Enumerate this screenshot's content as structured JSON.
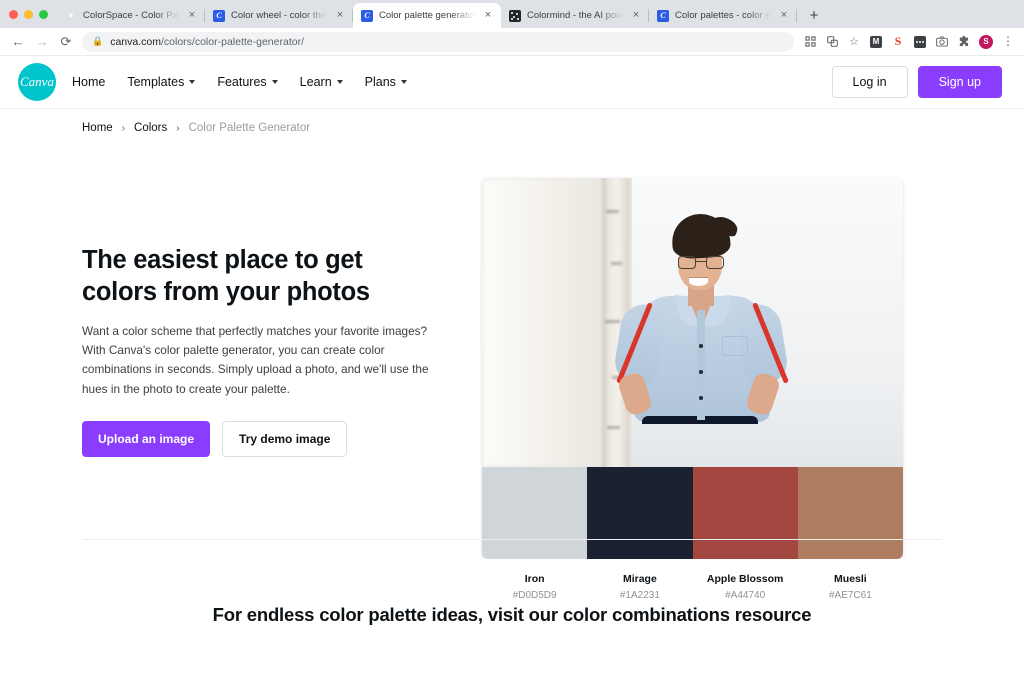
{
  "browser": {
    "traffic_lights": [
      "close",
      "minimize",
      "maximize"
    ],
    "tabs": [
      {
        "title": "ColorSpace - Color Palettes G",
        "favicon": "colorspace-icon",
        "active": false
      },
      {
        "title": "Color wheel - color theory and",
        "favicon": "canva-icon",
        "active": false
      },
      {
        "title": "Color palette generator | Canva",
        "favicon": "canva-icon",
        "active": true
      },
      {
        "title": "Colormind - the AI powered co",
        "favicon": "colormind-icon",
        "active": false
      },
      {
        "title": "Color palettes - color schemes",
        "favicon": "canva-icon",
        "active": false
      }
    ],
    "new_tab_label": "+",
    "back_label": "←",
    "forward_label": "→",
    "reload_label": "⟳",
    "lock_label": "🔒",
    "url_domain": "canva.com",
    "url_path": "/colors/color-palette-generator/",
    "toolbar_icons": [
      {
        "name": "qr-code-icon",
        "glyph": "⌨"
      },
      {
        "name": "translate-icon",
        "glyph": "文"
      },
      {
        "name": "bookmark-star-icon",
        "glyph": "☆"
      },
      {
        "name": "gmail-extension-icon",
        "glyph": "M"
      },
      {
        "name": "grammarly-extension-icon",
        "glyph": "S"
      },
      {
        "name": "screen-recorder-extension-icon",
        "glyph": ""
      },
      {
        "name": "screenshot-extension-icon",
        "glyph": "▭"
      },
      {
        "name": "extensions-puzzle-icon",
        "glyph": "✦"
      },
      {
        "name": "profile-avatar",
        "glyph": "S"
      },
      {
        "name": "chrome-menu-icon",
        "glyph": "⋮"
      }
    ]
  },
  "site": {
    "logo_text": "Canva",
    "nav_items": [
      {
        "label": "Home",
        "has_caret": false
      },
      {
        "label": "Templates",
        "has_caret": true
      },
      {
        "label": "Features",
        "has_caret": true
      },
      {
        "label": "Learn",
        "has_caret": true
      },
      {
        "label": "Plans",
        "has_caret": true
      }
    ],
    "login_label": "Log in",
    "signup_label": "Sign up",
    "accent_purple": "#8B3DFF",
    "brand_teal": "#00C4CC"
  },
  "breadcrumb": {
    "items": [
      "Home",
      "Colors",
      "Color Palette Generator"
    ],
    "separator": "›"
  },
  "hero": {
    "title": "The easiest place to get colors from your photos",
    "description": "Want a color scheme that perfectly matches your favorite images? With Canva's color palette generator, you can create color combinations in seconds. Simply upload a photo, and we'll use the hues in the photo to create your palette.",
    "upload_button": "Upload an image",
    "demo_button": "Try demo image",
    "photo_alt": "Smiling person with short dark hair and glasses wearing a light blue shirt with red sleeve stripes, hands on hips, in front of a bright white wall with a birch tree trunk"
  },
  "palette": [
    {
      "name": "Iron",
      "hex": "#D0D5D9"
    },
    {
      "name": "Mirage",
      "hex": "#1A2231"
    },
    {
      "name": "Apple Blossom",
      "hex": "#A44740"
    },
    {
      "name": "Muesli",
      "hex": "#AE7C61"
    }
  ],
  "bottom_section": {
    "heading": "For endless color palette ideas, visit our color combinations resource"
  }
}
